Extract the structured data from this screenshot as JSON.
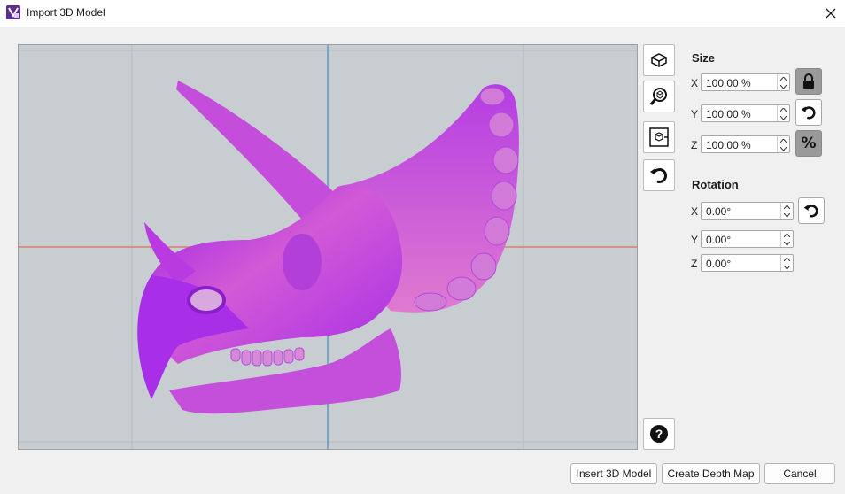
{
  "window": {
    "title": "Import 3D Model",
    "app_icon": "app-logo-icon",
    "close_icon": "close-icon"
  },
  "viewport": {
    "background": "#c8cdd2",
    "model_color": "#cc44dd",
    "x_axis_color": "#d8826a",
    "y_axis_color": "#5a9ccc"
  },
  "toolbar": {
    "buttons": [
      {
        "name": "top-view-button",
        "icon": "cube-top-icon"
      },
      {
        "name": "zoom-fit-button",
        "icon": "zoom-cube-icon"
      },
      {
        "name": "center-model-button",
        "icon": "cube-center-icon"
      },
      {
        "name": "reset-view-button",
        "icon": "reset-icon"
      }
    ],
    "help_icon": "help-icon"
  },
  "size": {
    "title": "Size",
    "x": {
      "label": "X",
      "value": "100.00 %"
    },
    "y": {
      "label": "Y",
      "value": "100.00 %"
    },
    "z": {
      "label": "Z",
      "value": "100.00 %"
    },
    "lock_icon": "lock-icon",
    "reset_icon": "reset-icon",
    "percent_label": "%"
  },
  "rotation": {
    "title": "Rotation",
    "x": {
      "label": "X",
      "value": "0.00°"
    },
    "y": {
      "label": "Y",
      "value": "0.00°"
    },
    "z": {
      "label": "Z",
      "value": "0.00°"
    },
    "reset_icon": "reset-icon"
  },
  "actions": {
    "insert": "Insert 3D Model",
    "depth_map": "Create Depth Map",
    "cancel": "Cancel"
  }
}
